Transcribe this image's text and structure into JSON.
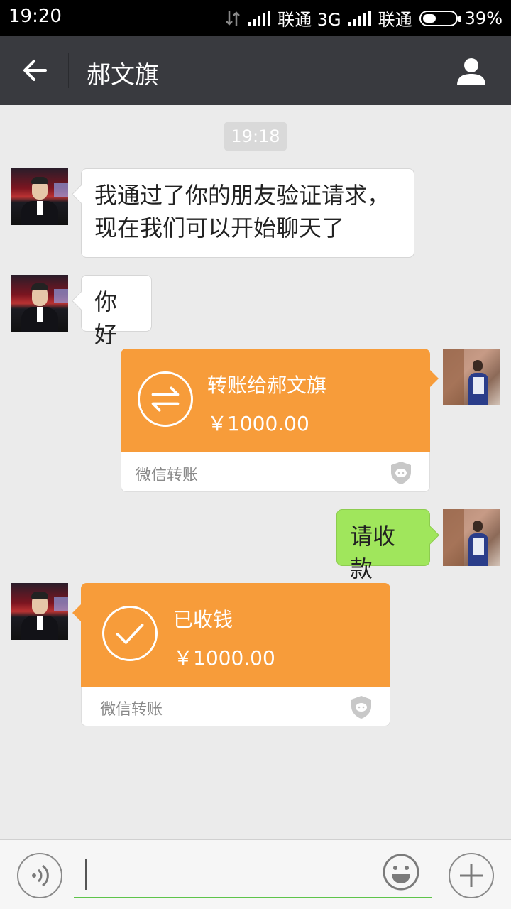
{
  "status_bar": {
    "time": "19:20",
    "carrier1": "联通 3G",
    "carrier2": "联通",
    "battery_text": "39%",
    "battery_level": 0.39
  },
  "header": {
    "back_icon": "back-arrow-icon",
    "title": "郝文旗",
    "profile_icon": "person-icon"
  },
  "chat": {
    "timestamp": "19:18",
    "messages": [
      {
        "from": "contact",
        "type": "text",
        "lines": [
          "我通过了你的朋友验证请求，",
          "现在我们可以开始聊天了"
        ]
      },
      {
        "from": "contact",
        "type": "text",
        "text": "你好"
      },
      {
        "from": "me",
        "type": "transfer",
        "title": "转账给郝文旗",
        "amount": "￥1000.00",
        "footer": "微信转账",
        "icon": "transfer-arrows-icon"
      },
      {
        "from": "me",
        "type": "text",
        "text": "请收款"
      },
      {
        "from": "contact",
        "type": "transfer",
        "title": "已收钱",
        "amount": "￥1000.00",
        "footer": "微信转账",
        "icon": "checkmark-icon"
      }
    ]
  },
  "input_bar": {
    "voice_icon": "voice-icon",
    "placeholder": "",
    "emoji_icon": "emoji-icon",
    "plus_icon": "plus-icon"
  },
  "colors": {
    "titlebar": "#393a3f",
    "transfer_orange": "#f79c3a",
    "my_bubble_green": "#a0e65c",
    "input_underline": "#5ec44a"
  }
}
